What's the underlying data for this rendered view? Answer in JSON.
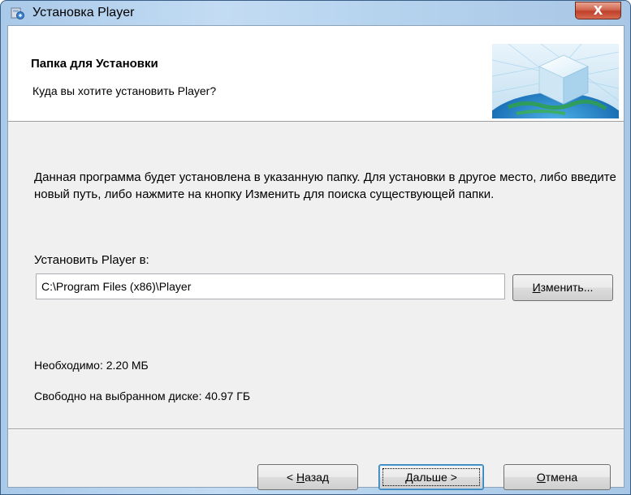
{
  "window": {
    "title": "Установка Player",
    "close_glyph": "X"
  },
  "header": {
    "title": "Папка для Установки",
    "subtitle": "Куда вы хотите установить Player?"
  },
  "content": {
    "description": "Данная программа будет установлена в указанную папку. Для установки в другое место, либо введите новый путь, либо нажмите на кнопку Изменить для поиска существующей папки.",
    "install_label": "Установить Player в:",
    "install_path": "C:\\Program Files (x86)\\Player",
    "change_button": {
      "accel": "И",
      "rest": "зменить..."
    },
    "required": "Необходимо: 2.20 МБ",
    "free_space": "Свободно на выбранном диске: 40.97 ГБ"
  },
  "buttons": {
    "back": {
      "prefix": "< ",
      "accel": "Н",
      "rest": "азад"
    },
    "next": {
      "accel": "Д",
      "rest": "альше >"
    },
    "cancel": {
      "accel": "О",
      "rest": "тмена"
    }
  },
  "colors": {
    "title_bar": "#b6d3ee",
    "close_button": "#c0402a",
    "client_bg": "#f0f0f0",
    "focus_border": "#3c7fb1"
  },
  "icons": {
    "title": "installer-icon",
    "banner": "install-cube-globe-banner"
  }
}
